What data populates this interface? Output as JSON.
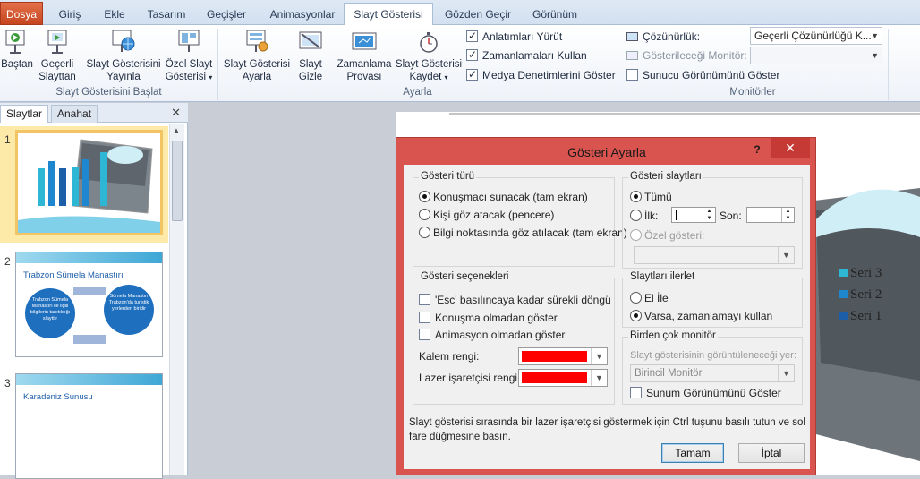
{
  "tabs": [
    {
      "label": "Dosya"
    },
    {
      "label": "Giriş"
    },
    {
      "label": "Ekle"
    },
    {
      "label": "Tasarım"
    },
    {
      "label": "Geçişler"
    },
    {
      "label": "Animasyonlar"
    },
    {
      "label": "Slayt Gösterisi"
    },
    {
      "label": "Gözden Geçir"
    },
    {
      "label": "Görünüm"
    }
  ],
  "ribbon": {
    "btn_bastan": [
      "Baştan",
      ""
    ],
    "btn_gecerli": [
      "Geçerli",
      "Slayttan"
    ],
    "btn_yayinla": [
      "Slayt Gösterisini",
      "Yayınla"
    ],
    "btn_ozel": [
      "Özel Slayt",
      "Gösterisi"
    ],
    "btn_ayarla": [
      "Slayt Gösterisi",
      "Ayarla"
    ],
    "btn_gizle": [
      "Slayt",
      "Gizle"
    ],
    "btn_zamanlama": [
      "Zamanlama",
      "Provası"
    ],
    "btn_kaydet": [
      "Slayt Gösterisi",
      "Kaydet"
    ],
    "chk_anlatim": "Anlatımları Yürüt",
    "chk_zamanlama": "Zamanlamaları Kullan",
    "chk_medya": "Medya Denetimlerini Göster",
    "cozunurluk_label": "Çözünürlük:",
    "cozunurluk_value": "Geçerli Çözünürlüğü K...",
    "monitor_label": "Gösterileceği Monitör:",
    "monitor_value": "",
    "sunucu_label": "Sunucu Görünümünü Göster",
    "group_baslat": "Slayt Gösterisini Başlat",
    "group_ayarla": "Ayarla",
    "group_monitorler": "Monitörler"
  },
  "leftpane": {
    "tab_slaytlar": "Slaytlar",
    "tab_anahat": "Anahat",
    "close": "✕",
    "slides": [
      {
        "num": "1"
      },
      {
        "num": "2",
        "title": "Trabzon Sümela Manastırı",
        "left_circle": "Trabzon Sümela Manastırı ile ilgili bilgilerin tanıtıldığı slayttır",
        "right_circle": "Sümela Manastırı Trabzon'da turistik yerlerden biridir"
      },
      {
        "num": "3",
        "title": "Karadeniz Sunusu"
      }
    ]
  },
  "canvas": {
    "legend": [
      "Seri 3",
      "Seri 2",
      "Seri 1"
    ],
    "colors": {
      "seri3": "#2eb7d5",
      "seri2": "#1f87cf",
      "seri1": "#1c5ea8"
    }
  },
  "dialog": {
    "title": "Gösteri Ayarla",
    "help": "?",
    "close": "✕",
    "gosteri_turu": {
      "legend": "Gösteri türü",
      "opt1": "Konuşmacı sunacak (tam ekran)",
      "opt2": "Kişi göz atacak (pencere)",
      "opt3": "Bilgi noktasında göz atılacak (tam ekran)"
    },
    "gosteri_slaytlari": {
      "legend": "Gösteri slaytları",
      "tumu": "Tümü",
      "ilk": "İlk:",
      "son": "Son:",
      "ozel": "Özel gösteri:"
    },
    "gosteri_secenekleri": {
      "legend": "Gösteri seçenekleri",
      "opt1": "'Esc' basılıncaya kadar sürekli döngü",
      "opt2": "Konuşma olmadan göster",
      "opt3": "Animasyon olmadan göster",
      "kalem": "Kalem rengi:",
      "lazer": "Lazer işaretçisi rengi:",
      "kalem_color": "#ff0000",
      "lazer_color": "#ff0000"
    },
    "ilerlet": {
      "legend": "Slaytları ilerlet",
      "el": "El İle",
      "varsa": "Varsa, zamanlamayı kullan"
    },
    "monitor": {
      "legend": "Birden çok monitör",
      "label": "Slayt gösterisinin görüntüleneceği yer:",
      "value": "Birincil Monitör",
      "sunum": "Sunum Görünümünü Göster"
    },
    "info": "Slayt gösterisi sırasında bir lazer işaretçisi göstermek için Ctrl tuşunu basılı tutun ve sol fare düğmesine basın.",
    "ok": "Tamam",
    "cancel": "İptal"
  }
}
